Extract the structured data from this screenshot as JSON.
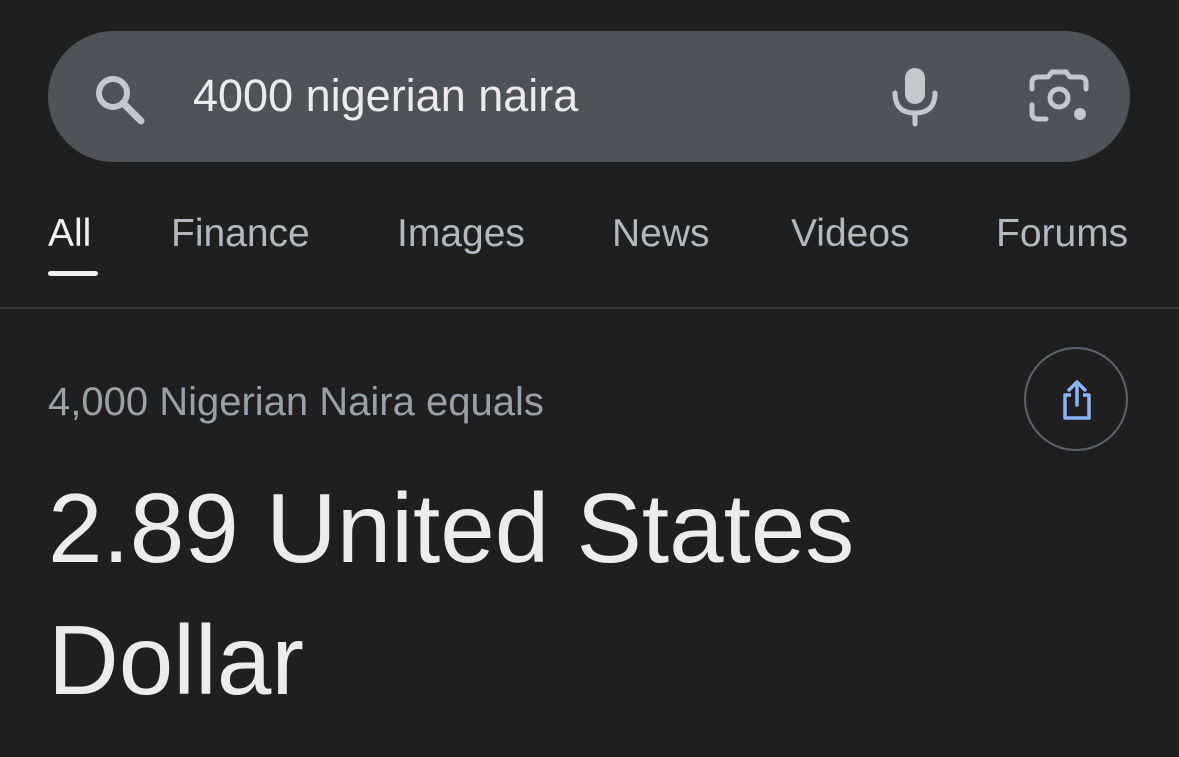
{
  "search": {
    "query": "4000 nigerian naira",
    "icons": {
      "search": "search-icon",
      "voice": "mic-icon",
      "lens": "camera-lens-icon"
    }
  },
  "tabs": [
    {
      "label": "All",
      "active": true
    },
    {
      "label": "Finance",
      "active": false
    },
    {
      "label": "Images",
      "active": false
    },
    {
      "label": "News",
      "active": false
    },
    {
      "label": "Videos",
      "active": false
    },
    {
      "label": "Forums",
      "active": false
    }
  ],
  "conversion": {
    "subtitle": "4,000 Nigerian Naira equals",
    "result": "2.89 United States Dollar",
    "share_icon": "share-icon"
  },
  "colors": {
    "background": "#1f1f1f",
    "search_bar": "#4f5257",
    "accent_share": "#8ab4f8",
    "muted_text": "#9aa0a6"
  }
}
